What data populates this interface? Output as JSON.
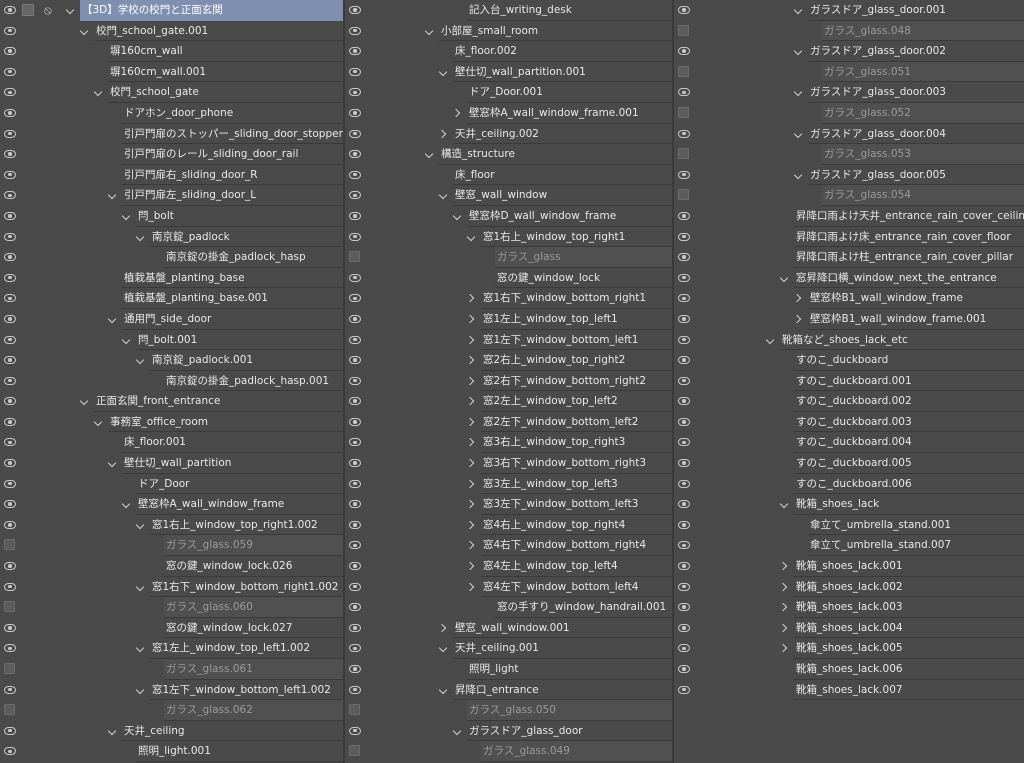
{
  "panel": {
    "columns": [
      [
        {
          "label": "【3D】学校の校門と正面玄関",
          "d": 0,
          "arrow": "open",
          "g": "eye",
          "sel": true,
          "root": true
        },
        {
          "label": "校門_school_gate.001",
          "d": 1,
          "arrow": "open",
          "g": "eye"
        },
        {
          "label": "塀160cm_wall",
          "d": 2,
          "arrow": "none",
          "g": "eye"
        },
        {
          "label": "塀160cm_wall.001",
          "d": 2,
          "arrow": "none",
          "g": "eye"
        },
        {
          "label": "校門_school_gate",
          "d": 2,
          "arrow": "open",
          "g": "eye"
        },
        {
          "label": "ドアホン_door_phone",
          "d": 3,
          "arrow": "none",
          "g": "eye"
        },
        {
          "label": "引戸門扉のストッパー_sliding_door_stopper",
          "d": 3,
          "arrow": "none",
          "g": "eye"
        },
        {
          "label": "引戸門扉のレール_sliding_door_rail",
          "d": 3,
          "arrow": "none",
          "g": "eye"
        },
        {
          "label": "引戸門扉右_sliding_door_R",
          "d": 3,
          "arrow": "none",
          "g": "eye"
        },
        {
          "label": "引戸門扉左_sliding_door_L",
          "d": 3,
          "arrow": "open",
          "g": "eye"
        },
        {
          "label": "閂_bolt",
          "d": 4,
          "arrow": "open",
          "g": "eye"
        },
        {
          "label": "南京錠_padlock",
          "d": 5,
          "arrow": "open",
          "g": "eye"
        },
        {
          "label": "南京錠の掛金_padlock_hasp",
          "d": 6,
          "arrow": "none",
          "g": "eye"
        },
        {
          "label": "植栽基盤_planting_base",
          "d": 3,
          "arrow": "none",
          "g": "eye"
        },
        {
          "label": "植栽基盤_planting_base.001",
          "d": 3,
          "arrow": "none",
          "g": "eye"
        },
        {
          "label": "通用門_side_door",
          "d": 3,
          "arrow": "open",
          "g": "eye"
        },
        {
          "label": "閂_bolt.001",
          "d": 4,
          "arrow": "open",
          "g": "eye"
        },
        {
          "label": "南京錠_padlock.001",
          "d": 5,
          "arrow": "open",
          "g": "eye"
        },
        {
          "label": "南京錠の掛金_padlock_hasp.001",
          "d": 6,
          "arrow": "none",
          "g": "eye"
        },
        {
          "label": "正面玄関_front_entrance",
          "d": 1,
          "arrow": "open",
          "g": "eye"
        },
        {
          "label": "事務室_office_room",
          "d": 2,
          "arrow": "open",
          "g": "eye"
        },
        {
          "label": "床_floor.001",
          "d": 3,
          "arrow": "none",
          "g": "eye"
        },
        {
          "label": "壁仕切_wall_partition",
          "d": 3,
          "arrow": "open",
          "g": "eye"
        },
        {
          "label": "ドア_Door",
          "d": 4,
          "arrow": "none",
          "g": "eye"
        },
        {
          "label": "壁窓枠A_wall_window_frame",
          "d": 4,
          "arrow": "open",
          "g": "eye"
        },
        {
          "label": "窓1右上_window_top_right1.002",
          "d": 5,
          "arrow": "open",
          "g": "eye"
        },
        {
          "label": "ガラス_glass.059",
          "d": 6,
          "arrow": "none",
          "g": "chk",
          "dim": true
        },
        {
          "label": "窓の鍵_window_lock.026",
          "d": 6,
          "arrow": "none",
          "g": "eye"
        },
        {
          "label": "窓1右下_window_bottom_right1.002",
          "d": 5,
          "arrow": "open",
          "g": "eye"
        },
        {
          "label": "ガラス_glass.060",
          "d": 6,
          "arrow": "none",
          "g": "chk",
          "dim": true
        },
        {
          "label": "窓の鍵_window_lock.027",
          "d": 6,
          "arrow": "none",
          "g": "eye"
        },
        {
          "label": "窓1左上_window_top_left1.002",
          "d": 5,
          "arrow": "open",
          "g": "eye"
        },
        {
          "label": "ガラス_glass.061",
          "d": 6,
          "arrow": "none",
          "g": "chk",
          "dim": true
        },
        {
          "label": "窓1左下_window_bottom_left1.002",
          "d": 5,
          "arrow": "open",
          "g": "eye"
        },
        {
          "label": "ガラス_glass.062",
          "d": 6,
          "arrow": "none",
          "g": "chk",
          "dim": true
        },
        {
          "label": "天井_ceiling",
          "d": 3,
          "arrow": "open",
          "g": "eye"
        },
        {
          "label": "照明_light.001",
          "d": 4,
          "arrow": "none",
          "g": "eye"
        }
      ],
      [
        {
          "label": "記入台_writing_desk",
          "d": 2,
          "arrow": "none",
          "g": "eye"
        },
        {
          "label": "小部屋_small_room",
          "d": 0,
          "arrow": "open",
          "g": "eye"
        },
        {
          "label": "床_floor.002",
          "d": 1,
          "arrow": "none",
          "g": "eye"
        },
        {
          "label": "壁仕切_wall_partition.001",
          "d": 1,
          "arrow": "open",
          "g": "eye"
        },
        {
          "label": "ドア_Door.001",
          "d": 2,
          "arrow": "none",
          "g": "eye"
        },
        {
          "label": "壁窓枠A_wall_window_frame.001",
          "d": 2,
          "arrow": "closed",
          "g": "eye"
        },
        {
          "label": "天井_ceiling.002",
          "d": 1,
          "arrow": "closed",
          "g": "eye"
        },
        {
          "label": "構造_structure",
          "d": 0,
          "arrow": "open",
          "g": "eye"
        },
        {
          "label": "床_floor",
          "d": 1,
          "arrow": "none",
          "g": "eye"
        },
        {
          "label": "壁窓_wall_window",
          "d": 1,
          "arrow": "open",
          "g": "eye"
        },
        {
          "label": "壁窓枠D_wall_window_frame",
          "d": 2,
          "arrow": "open",
          "g": "eye"
        },
        {
          "label": "窓1右上_window_top_right1",
          "d": 3,
          "arrow": "open",
          "g": "eye"
        },
        {
          "label": "ガラス_glass",
          "d": 4,
          "arrow": "none",
          "g": "chk",
          "dim": true
        },
        {
          "label": "窓の鍵_window_lock",
          "d": 4,
          "arrow": "none",
          "g": "eye"
        },
        {
          "label": "窓1右下_window_bottom_right1",
          "d": 3,
          "arrow": "closed",
          "g": "eye"
        },
        {
          "label": "窓1左上_window_top_left1",
          "d": 3,
          "arrow": "closed",
          "g": "eye"
        },
        {
          "label": "窓1左下_window_bottom_left1",
          "d": 3,
          "arrow": "closed",
          "g": "eye"
        },
        {
          "label": "窓2右上_window_top_right2",
          "d": 3,
          "arrow": "closed",
          "g": "eye"
        },
        {
          "label": "窓2右下_window_bottom_right2",
          "d": 3,
          "arrow": "closed",
          "g": "eye"
        },
        {
          "label": "窓2左上_window_top_left2",
          "d": 3,
          "arrow": "closed",
          "g": "eye"
        },
        {
          "label": "窓2左下_window_bottom_left2",
          "d": 3,
          "arrow": "closed",
          "g": "eye"
        },
        {
          "label": "窓3右上_window_top_right3",
          "d": 3,
          "arrow": "closed",
          "g": "eye"
        },
        {
          "label": "窓3右下_window_bottom_right3",
          "d": 3,
          "arrow": "closed",
          "g": "eye"
        },
        {
          "label": "窓3左上_window_top_left3",
          "d": 3,
          "arrow": "closed",
          "g": "eye"
        },
        {
          "label": "窓3左下_window_bottom_left3",
          "d": 3,
          "arrow": "closed",
          "g": "eye"
        },
        {
          "label": "窓4右上_window_top_right4",
          "d": 3,
          "arrow": "closed",
          "g": "eye"
        },
        {
          "label": "窓4右下_window_bottom_right4",
          "d": 3,
          "arrow": "closed",
          "g": "eye"
        },
        {
          "label": "窓4左上_window_top_left4",
          "d": 3,
          "arrow": "closed",
          "g": "eye"
        },
        {
          "label": "窓4左下_window_bottom_left4",
          "d": 3,
          "arrow": "closed",
          "g": "eye"
        },
        {
          "label": "窓の手すり_window_handrail.001",
          "d": 4,
          "arrow": "none",
          "g": "eye"
        },
        {
          "label": "壁窓_wall_window.001",
          "d": 1,
          "arrow": "closed",
          "g": "eye"
        },
        {
          "label": "天井_ceiling.001",
          "d": 1,
          "arrow": "open",
          "g": "eye"
        },
        {
          "label": "照明_light",
          "d": 2,
          "arrow": "none",
          "g": "eye"
        },
        {
          "label": "昇降口_entrance",
          "d": 1,
          "arrow": "open",
          "g": "eye"
        },
        {
          "label": "ガラス_glass.050",
          "d": 2,
          "arrow": "none",
          "g": "chk",
          "dim": true
        },
        {
          "label": "ガラスドア_glass_door",
          "d": 2,
          "arrow": "open",
          "g": "eye"
        },
        {
          "label": "ガラス_glass.049",
          "d": 3,
          "arrow": "none",
          "g": "chk",
          "dim": true
        }
      ],
      [
        {
          "label": "ガラスドア_glass_door.001",
          "d": 3,
          "arrow": "open",
          "g": "eye"
        },
        {
          "label": "ガラス_glass.048",
          "d": 4,
          "arrow": "none",
          "g": "chk",
          "dim": true
        },
        {
          "label": "ガラスドア_glass_door.002",
          "d": 3,
          "arrow": "open",
          "g": "eye"
        },
        {
          "label": "ガラス_glass.051",
          "d": 4,
          "arrow": "none",
          "g": "chk",
          "dim": true
        },
        {
          "label": "ガラスドア_glass_door.003",
          "d": 3,
          "arrow": "open",
          "g": "eye"
        },
        {
          "label": "ガラス_glass.052",
          "d": 4,
          "arrow": "none",
          "g": "chk",
          "dim": true
        },
        {
          "label": "ガラスドア_glass_door.004",
          "d": 3,
          "arrow": "open",
          "g": "eye"
        },
        {
          "label": "ガラス_glass.053",
          "d": 4,
          "arrow": "none",
          "g": "chk",
          "dim": true
        },
        {
          "label": "ガラスドア_glass_door.005",
          "d": 3,
          "arrow": "open",
          "g": "eye"
        },
        {
          "label": "ガラス_glass.054",
          "d": 4,
          "arrow": "none",
          "g": "chk",
          "dim": true
        },
        {
          "label": "昇降口雨よけ天井_entrance_rain_cover_ceiling",
          "d": 2,
          "arrow": "none",
          "g": "eye"
        },
        {
          "label": "昇降口雨よけ床_entrance_rain_cover_floor",
          "d": 2,
          "arrow": "none",
          "g": "eye"
        },
        {
          "label": "昇降口雨よけ柱_entrance_rain_cover_pillar",
          "d": 2,
          "arrow": "none",
          "g": "eye"
        },
        {
          "label": "窓昇降口横_window_next_the_entrance",
          "d": 2,
          "arrow": "open",
          "g": "eye"
        },
        {
          "label": "壁窓枠B1_wall_window_frame",
          "d": 3,
          "arrow": "closed",
          "g": "eye"
        },
        {
          "label": "壁窓枠B1_wall_window_frame.001",
          "d": 3,
          "arrow": "closed",
          "g": "eye"
        },
        {
          "label": "靴箱など_shoes_lack_etc",
          "d": 1,
          "arrow": "open",
          "g": "eye"
        },
        {
          "label": "すのこ_duckboard",
          "d": 2,
          "arrow": "none",
          "g": "eye"
        },
        {
          "label": "すのこ_duckboard.001",
          "d": 2,
          "arrow": "none",
          "g": "eye"
        },
        {
          "label": "すのこ_duckboard.002",
          "d": 2,
          "arrow": "none",
          "g": "eye"
        },
        {
          "label": "すのこ_duckboard.003",
          "d": 2,
          "arrow": "none",
          "g": "eye"
        },
        {
          "label": "すのこ_duckboard.004",
          "d": 2,
          "arrow": "none",
          "g": "eye"
        },
        {
          "label": "すのこ_duckboard.005",
          "d": 2,
          "arrow": "none",
          "g": "eye"
        },
        {
          "label": "すのこ_duckboard.006",
          "d": 2,
          "arrow": "none",
          "g": "eye"
        },
        {
          "label": "靴箱_shoes_lack",
          "d": 2,
          "arrow": "open",
          "g": "eye"
        },
        {
          "label": "傘立て_umbrella_stand.001",
          "d": 3,
          "arrow": "none",
          "g": "eye"
        },
        {
          "label": "傘立て_umbrella_stand.007",
          "d": 3,
          "arrow": "none",
          "g": "eye"
        },
        {
          "label": "靴箱_shoes_lack.001",
          "d": 2,
          "arrow": "closed",
          "g": "eye"
        },
        {
          "label": "靴箱_shoes_lack.002",
          "d": 2,
          "arrow": "closed",
          "g": "eye"
        },
        {
          "label": "靴箱_shoes_lack.003",
          "d": 2,
          "arrow": "closed",
          "g": "eye"
        },
        {
          "label": "靴箱_shoes_lack.004",
          "d": 2,
          "arrow": "closed",
          "g": "eye"
        },
        {
          "label": "靴箱_shoes_lack.005",
          "d": 2,
          "arrow": "closed",
          "g": "eye"
        },
        {
          "label": "靴箱_shoes_lack.006",
          "d": 2,
          "arrow": "none",
          "g": "eye"
        },
        {
          "label": "靴箱_shoes_lack.007",
          "d": 2,
          "arrow": "none",
          "g": "eye"
        }
      ]
    ],
    "icons": {
      "visibility": "eye-icon",
      "locked": "checkbox-icon",
      "expand": "chevron-down-icon",
      "collapse": "chevron-right-icon",
      "link": "link-icon"
    }
  }
}
